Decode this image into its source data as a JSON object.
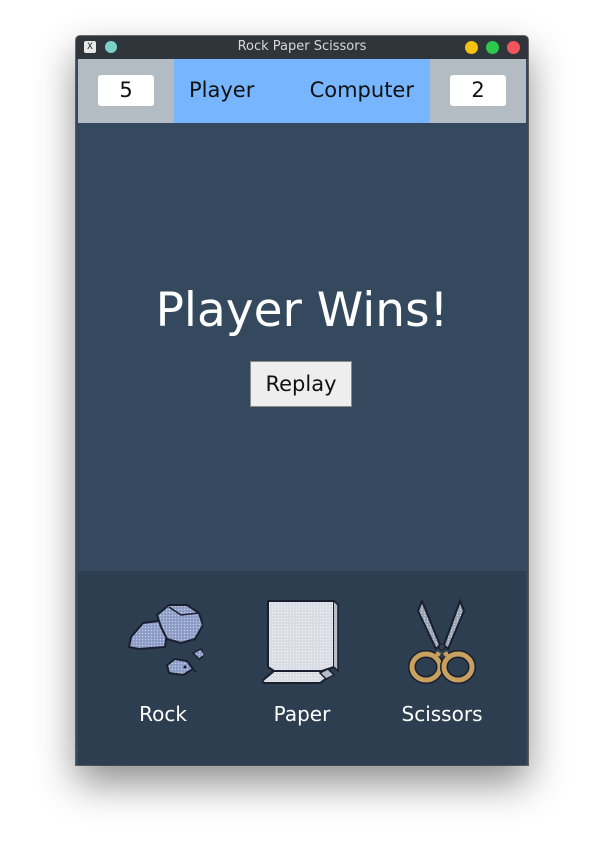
{
  "window": {
    "title": "Rock Paper Scissors",
    "app_icon": "x-window-icon"
  },
  "scoreboard": {
    "player_score": "5",
    "player_label": "Player",
    "computer_label": "Computer",
    "computer_score": "2"
  },
  "result": {
    "message": "Player Wins!",
    "replay_label": "Replay"
  },
  "choices": [
    {
      "label": "Rock",
      "icon": "rock-icon"
    },
    {
      "label": "Paper",
      "icon": "paper-icon"
    },
    {
      "label": "Scissors",
      "icon": "scissors-icon"
    }
  ],
  "colors": {
    "background": "#34495e",
    "choices_bar": "#2c3e50",
    "names_panel": "#77b5fe",
    "scorebar": "#b2bcc2"
  }
}
